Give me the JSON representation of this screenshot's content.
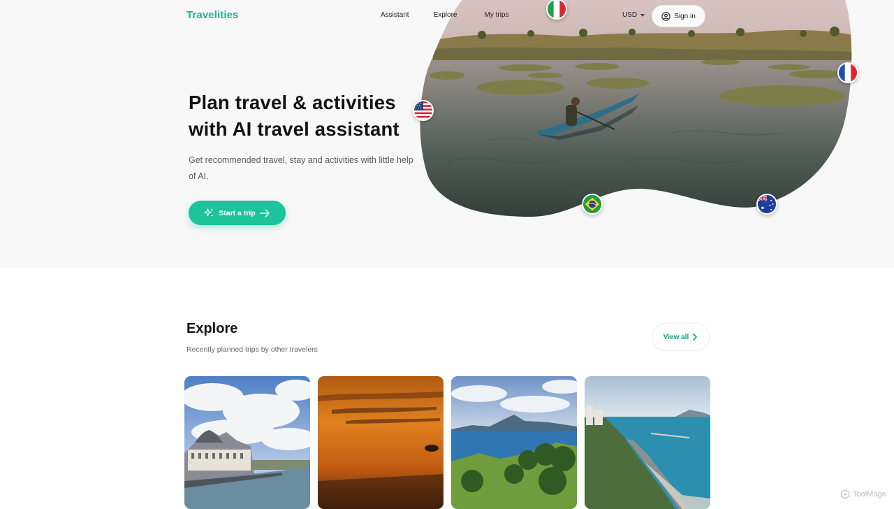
{
  "header": {
    "logo": "Travelities",
    "nav": [
      "Assistant",
      "Explore",
      "My trips"
    ],
    "currency": "USD",
    "signin": "Sign in"
  },
  "hero": {
    "title": "Plan travel & activities with AI travel assistant",
    "subtitle": "Get recommended travel, stay and activities with little help of AI.",
    "cta": "Start a trip",
    "flags": [
      "italy-flag",
      "france-flag",
      "usa-flag",
      "brazil-flag",
      "australia-flag"
    ]
  },
  "explore": {
    "title": "Explore",
    "subtitle": "Recently planned trips by other travelers",
    "view_all": "View all",
    "cards": [
      "paris-musee-orsay-photo",
      "sunset-sea-photo",
      "tropical-island-photo",
      "coastal-cliff-city-photo"
    ]
  },
  "watermark": "ToolMage",
  "colors": {
    "accent": "#1cc39b",
    "logo": "#1bb592",
    "hero_bg": "#f8f8f8"
  }
}
